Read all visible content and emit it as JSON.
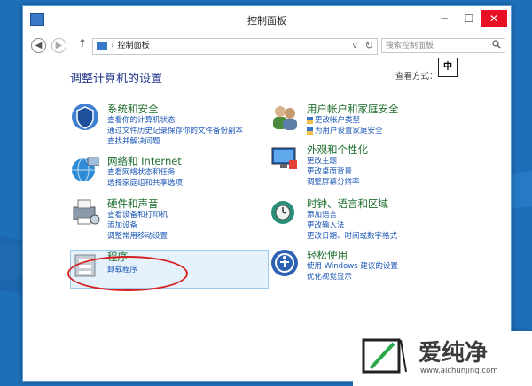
{
  "window": {
    "title": "控制面板"
  },
  "title_buttons": {
    "minimize": "─",
    "maximize": "☐",
    "close": "✕"
  },
  "nav": {
    "back": "◀",
    "forward": "▶",
    "up": "↑",
    "address_sep": "›",
    "address": "控制面板",
    "dropdown": "v",
    "refresh": "↻",
    "search_placeholder": "搜索控制面板",
    "search_icon": "🔍"
  },
  "heading": "调整计算机的设置",
  "view_by": {
    "label": "查看方式："
  },
  "ime_indicator": "中",
  "categories": {
    "system": {
      "title": "系统和安全",
      "links": [
        "查看你的计算机状态",
        "通过文件历史记录保存你的文件备份副本",
        "查找并解决问题"
      ],
      "icon": "shield-icon",
      "color": "#2a6fc4"
    },
    "network": {
      "title": "网络和 Internet",
      "links": [
        "查看网络状态和任务",
        "选择家庭组和共享选项"
      ],
      "icon": "globe-network-icon",
      "color": "#2e8bd6"
    },
    "hardware": {
      "title": "硬件和声音",
      "links": [
        "查看设备和打印机",
        "添加设备",
        "调整常用移动设置"
      ],
      "icon": "printer-icon",
      "color": "#7d8ea3"
    },
    "programs": {
      "title": "程序",
      "links": [
        "卸载程序"
      ],
      "icon": "programs-icon",
      "color": "#9aa4b0"
    },
    "user": {
      "title": "用户帐户和家庭安全",
      "links": [
        "更改帐户类型",
        "为用户设置家庭安全"
      ],
      "icon": "users-icon",
      "color": "#4a8a3a"
    },
    "appearance": {
      "title": "外观和个性化",
      "links": [
        "更改主题",
        "更改桌面背景",
        "调整屏幕分辨率"
      ],
      "icon": "display-icon",
      "color": "#3a7fd0"
    },
    "clock": {
      "title": "时钟、语言和区域",
      "links": [
        "添加语言",
        "更改输入法",
        "更改日期、时间或数字格式"
      ],
      "icon": "clock-globe-icon",
      "color": "#2a8f7a"
    },
    "ease": {
      "title": "轻松使用",
      "links": [
        "使用 Windows 建议的设置",
        "优化视觉显示"
      ],
      "icon": "ease-of-access-icon",
      "color": "#2d62b3"
    }
  },
  "watermark": {
    "brand": "爱纯净",
    "url": "www.aichunjing.com"
  }
}
